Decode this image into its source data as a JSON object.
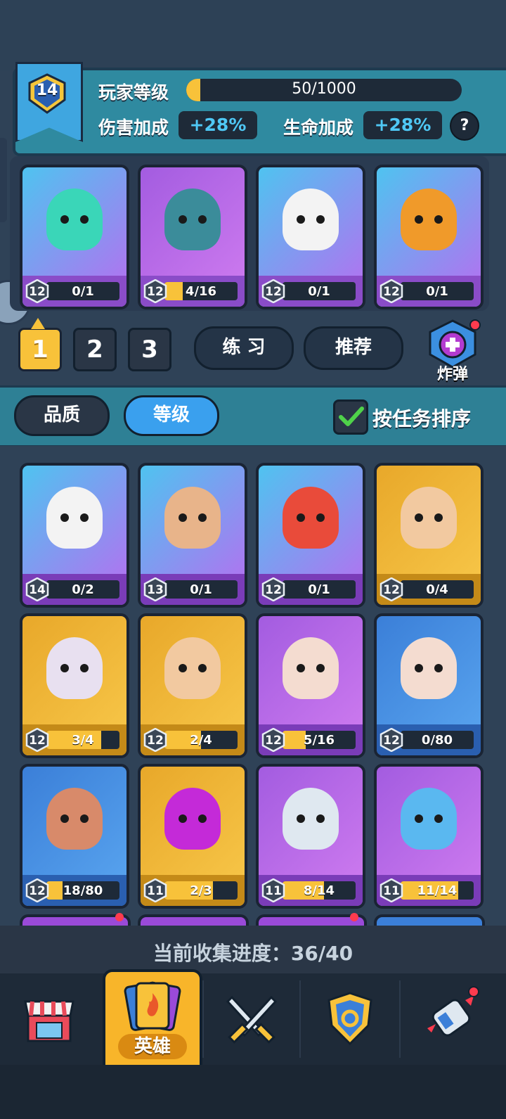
{
  "player": {
    "level": "14",
    "level_label": "玩家等级",
    "xp": "50/1000",
    "xp_fraction": 0.05,
    "damage_label": "伤害加成",
    "damage_value": "+28%",
    "health_label": "生命加成",
    "health_value": "+28%",
    "help": "?"
  },
  "deck": [
    {
      "level": "12",
      "progress": "0/1",
      "fill": 0
    },
    {
      "level": "12",
      "progress": "4/16",
      "fill": 0.25
    },
    {
      "level": "12",
      "progress": "0/1",
      "fill": 0
    },
    {
      "level": "12",
      "progress": "0/1",
      "fill": 0
    }
  ],
  "deck_tabs": [
    "1",
    "2",
    "3"
  ],
  "buttons": {
    "practice": "练 习",
    "recommend": "推荐",
    "bomb": "炸弹"
  },
  "filters": {
    "quality": "品质",
    "level": "等级",
    "sort_by_task": "按任务排序"
  },
  "heroes": [
    {
      "level": "14",
      "progress": "0/2",
      "fill": 0
    },
    {
      "level": "13",
      "progress": "0/1",
      "fill": 0
    },
    {
      "level": "12",
      "progress": "0/1",
      "fill": 0
    },
    {
      "level": "12",
      "progress": "0/4",
      "fill": 0
    },
    {
      "level": "12",
      "progress": "3/4",
      "fill": 0.75
    },
    {
      "level": "12",
      "progress": "2/4",
      "fill": 0.5
    },
    {
      "level": "12",
      "progress": "5/16",
      "fill": 0.3125
    },
    {
      "level": "12",
      "progress": "0/80",
      "fill": 0
    },
    {
      "level": "12",
      "progress": "18/80",
      "fill": 0.225
    },
    {
      "level": "11",
      "progress": "2/3",
      "fill": 0.667
    },
    {
      "level": "11",
      "progress": "8/14",
      "fill": 0.571
    },
    {
      "level": "11",
      "progress": "11/14",
      "fill": 0.786
    }
  ],
  "collection": {
    "label": "当前收集进度：",
    "value": "36/40"
  },
  "nav": {
    "heroes_label": "英雄"
  },
  "colors": {
    "accent_yellow": "#f8c23a",
    "accent_blue": "#4fc8f5",
    "teal_band": "#2e8095",
    "notify_red": "#ff3b4e"
  }
}
